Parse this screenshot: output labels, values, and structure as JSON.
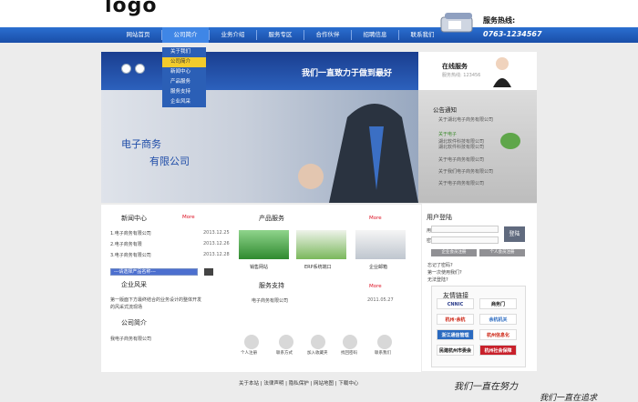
{
  "logo": "logo",
  "hotline_label": "服务热线:",
  "hotline_number": "0763-1234567",
  "nav": [
    "网站首页",
    "公司简介",
    "业务介绍",
    "服务专区",
    "合作伙伴",
    "招聘信息",
    "联系我们"
  ],
  "submenu": [
    "关于我们",
    "公司简介",
    "新闻中心",
    "产品服务",
    "服务支持",
    "企业风采"
  ],
  "banner": {
    "slogan": "我们一直致力于做到最好",
    "line1": "电子商务",
    "line2": "有限公司"
  },
  "service": {
    "title": "在线服务",
    "sub": "服务热线: 123456"
  },
  "notice": {
    "title": "公告通知",
    "items": [
      "关于湖北电子商务有限公司",
      "关于电子",
      "湖北软件科技有限公司",
      "湖北软件科技有限公司",
      "关于电子商务有限公司",
      "关于我们电子商务有限公司",
      "关于电子商务有限公司"
    ]
  },
  "news": {
    "title": "新闻中心",
    "more": "More",
    "items": [
      {
        "t": "1.电子商务有限公司",
        "d": "2013.12.25"
      },
      {
        "t": "2.电子商务有限",
        "d": "2013.12.26"
      },
      {
        "t": "3.电子商务有限公司",
        "d": "2013.12.28"
      }
    ],
    "select": "---请选择产品名称---"
  },
  "culture": {
    "title": "企业风采",
    "text1": "第一版面下方最终结合的业务设计的整体开发",
    "text2": "的风采式流现场"
  },
  "about": {
    "title": "公司简介",
    "text": "我电子商务有限公司"
  },
  "products": {
    "title": "产品服务",
    "more": "More",
    "caps": [
      "销售网站",
      "ERP系统端口",
      "企业邮箱"
    ]
  },
  "support": {
    "title": "服务支持",
    "more": "More",
    "line": "电子商务有限公司",
    "date": "2011.05.27",
    "icons": [
      "个人注册",
      "联系方式",
      "加入收藏夹",
      "找回密码",
      "联系我们"
    ]
  },
  "login": {
    "title": "用户登陆",
    "user": "用户名",
    "pass": "密 码",
    "btn": "登陆",
    "reg": "企业会员注册",
    "reg2": "个人会员注册",
    "help1": "忘记了密码?",
    "help2": "第一次使用我们?",
    "help3": "无法登陆?"
  },
  "links": {
    "title": "友情链接",
    "tiles": [
      "CNNIC",
      "商务门",
      "杭州·余杭",
      "余杭机关",
      "浙江通信管理",
      "杭州信息化",
      "杭州社会保障",
      "民建杭州市委会"
    ]
  },
  "footer": "关于本站 | 法律声明 | 隐私保护 | 网站地图 | 下载中心",
  "hand1": "我们一直在努力",
  "hand2": "我们一直在追求"
}
